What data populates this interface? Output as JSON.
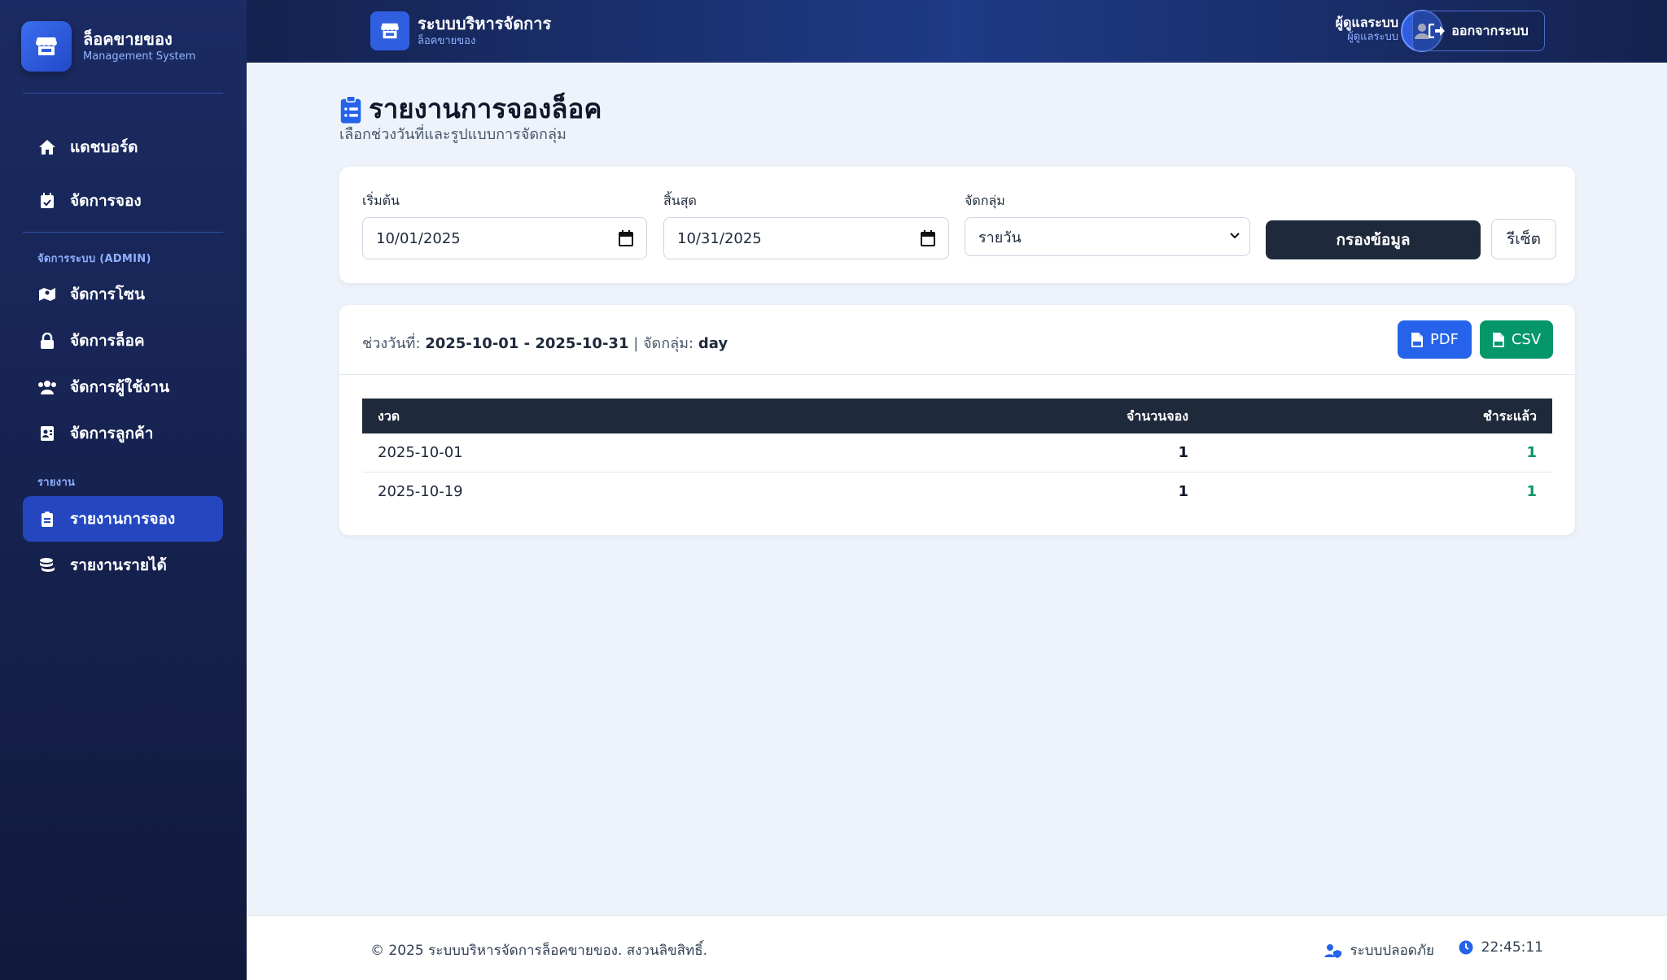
{
  "sidebar": {
    "brand_title": "ล็อคขายของ",
    "brand_sub": "Management System",
    "items": [
      {
        "label": "แดชบอร์ด",
        "icon": "home-icon"
      },
      {
        "label": "จัดการจอง",
        "icon": "calendar-check-icon"
      }
    ],
    "admin_section": "จัดการระบบ (ADMIN)",
    "admin_items": [
      {
        "label": "จัดการโซน",
        "icon": "map-icon"
      },
      {
        "label": "จัดการล็อค",
        "icon": "lock-icon"
      },
      {
        "label": "จัดการผู้ใช้งาน",
        "icon": "users-icon"
      },
      {
        "label": "จัดการลูกค้า",
        "icon": "id-card-icon"
      }
    ],
    "report_section": "รายงาน",
    "report_items": [
      {
        "label": "รายงานการจอง",
        "icon": "clipboard-list-icon",
        "active": true
      },
      {
        "label": "รายงานรายได้",
        "icon": "coins-icon"
      }
    ]
  },
  "header": {
    "title": "ระบบบริหารจัดการ",
    "subtitle": "ล็อคขายของ",
    "user_name": "ผู้ดูแลระบบ",
    "user_role": "ผู้ดูแลระบบ",
    "logout_label": "ออกจากระบบ"
  },
  "page": {
    "title": "รายงานการจองล็อค",
    "subtitle": "เลือกช่วงวันที่และรูปแบบการจัดกลุ่ม"
  },
  "filter": {
    "start_label": "เริ่มต้น",
    "start_value": "10/01/2025",
    "end_label": "สิ้นสุด",
    "end_value": "10/31/2025",
    "group_label": "จัดกลุ่ม",
    "group_value": "รายวัน",
    "filter_button": "กรองข้อมูล",
    "reset_button": "รีเซ็ต"
  },
  "result": {
    "range_prefix": "ช่วงวันที่:",
    "range_value": "2025-10-01 - 2025-10-31",
    "group_prefix": "| จัดกลุ่ม:",
    "group_value": "day",
    "pdf_label": "PDF",
    "csv_label": "CSV",
    "columns": [
      "งวด",
      "จำนวนจอง",
      "ชำระแล้ว"
    ],
    "rows": [
      {
        "period": "2025-10-01",
        "count": "1",
        "paid": "1"
      },
      {
        "period": "2025-10-19",
        "count": "1",
        "paid": "1"
      }
    ]
  },
  "footer": {
    "copyright": "© 2025 ระบบบริหารจัดการล็อคขายของ. สงวนลิขสิทธิ์.",
    "secure_label": "ระบบปลอดภัย",
    "time": "22:45:11"
  },
  "colors": {
    "sidebar_active": "#2447c0",
    "primary": "#2563eb",
    "success": "#059669",
    "dark": "#1e293b"
  }
}
